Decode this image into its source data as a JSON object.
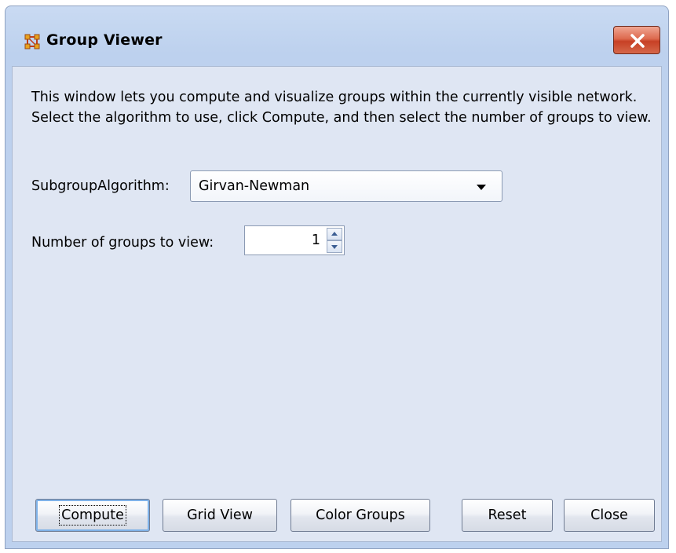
{
  "window": {
    "title": "Group Viewer",
    "icon": "group-viewer-app-icon",
    "close_icon": "close-x-icon"
  },
  "content": {
    "description": "This window lets you compute and visualize groups within the currently visible network. Select the algorithm to use, click Compute, and then select the number of groups to view.",
    "algorithm_label": "SubgroupAlgorithm:",
    "algorithm_value": "Girvan-Newman",
    "groups_label": "Number of groups to view:",
    "groups_value": "1"
  },
  "buttons": {
    "compute": "Compute",
    "grid_view": "Grid View",
    "color_groups": "Color Groups",
    "reset": "Reset",
    "close": "Close"
  },
  "colors": {
    "title_close_button": "#c74025",
    "client_background": "#dfe6f3",
    "frame_background": "#bdd1ee"
  }
}
